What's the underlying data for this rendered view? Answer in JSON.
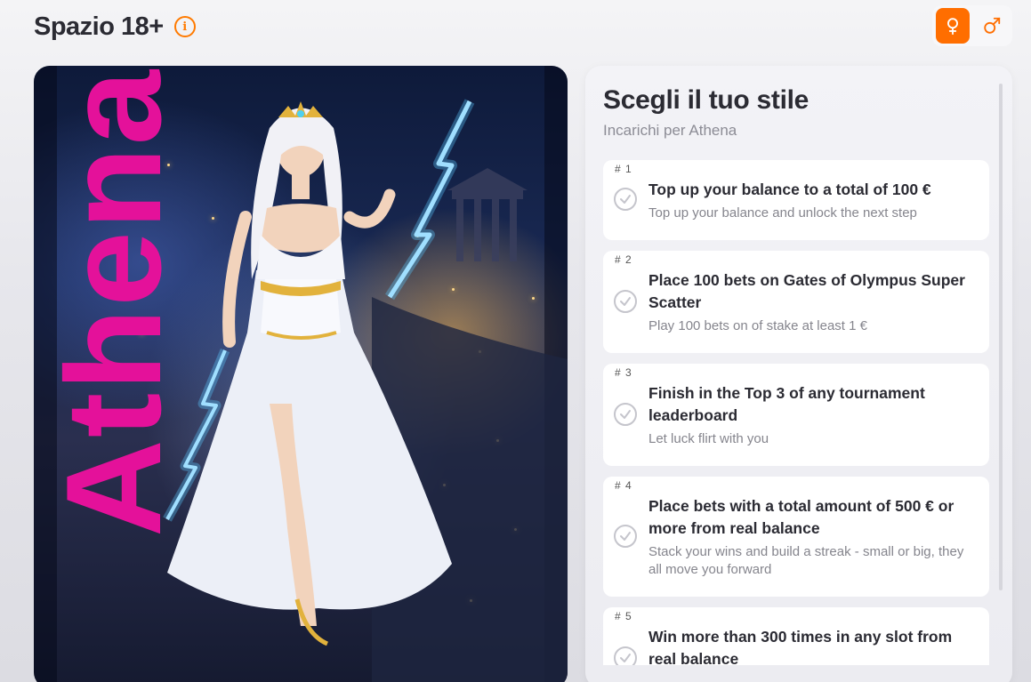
{
  "header": {
    "title": "Spazio 18+",
    "info_icon": "info-icon"
  },
  "gender_toggle": {
    "options": [
      {
        "icon": "female-symbol-icon",
        "active": true
      },
      {
        "icon": "male-symbol-icon",
        "active": false
      }
    ],
    "accent_color": "#ff6e00"
  },
  "hero": {
    "name": "Athena",
    "name_color": "#e4119a"
  },
  "panel": {
    "title": "Scegli il tuo stile",
    "subtitle": "Incarichi per Athena",
    "tasks": [
      {
        "number": "# 1",
        "title": "Top up your balance to a total of 100 €",
        "description": "Top up your balance and unlock the next step"
      },
      {
        "number": "# 2",
        "title": "Place 100 bets on Gates of Olympus Super Scatter",
        "description": "Play 100 bets on of stake at least 1 €"
      },
      {
        "number": "# 3",
        "title": "Finish in the Top 3 of any tournament leaderboard",
        "description": "Let luck flirt with you"
      },
      {
        "number": "# 4",
        "title": "Place bets with a total amount of 500 € or more from real balance",
        "description": "Stack your wins and build a streak - small or big, they all move you forward"
      },
      {
        "number": "# 5",
        "title": "Win more than 300 times in any slot from real balance",
        "description": ""
      }
    ]
  }
}
